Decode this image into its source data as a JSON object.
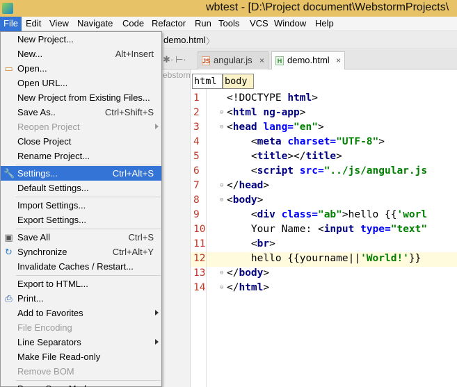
{
  "window": {
    "title": "wbtest - [D:\\Project document\\WebstormProjects\\"
  },
  "menubar": [
    "File",
    "Edit",
    "View",
    "Navigate",
    "Code",
    "Refactor",
    "Run",
    "Tools",
    "VCS",
    "Window",
    "Help"
  ],
  "navbar": {
    "breadcrumb": "demo.html"
  },
  "tabs": [
    {
      "label": "angular.js",
      "icon": "js-file-icon",
      "active": false
    },
    {
      "label": "demo.html",
      "icon": "html-file-icon",
      "active": true
    }
  ],
  "project_panel": {
    "label": "ebstorm"
  },
  "editor": {
    "crumbs": [
      "html",
      "body"
    ],
    "current_line": 12,
    "lines": [
      {
        "n": "1",
        "text": "<!DOCTYPE html>"
      },
      {
        "n": "2",
        "text": "<html ng-app>"
      },
      {
        "n": "3",
        "text": "<head lang=\"en\">"
      },
      {
        "n": "4",
        "text": "    <meta charset=\"UTF-8\">"
      },
      {
        "n": "5",
        "text": "    <title></title>"
      },
      {
        "n": "6",
        "text": "    <script src=\"../js/angular.js"
      },
      {
        "n": "7",
        "text": "</head>"
      },
      {
        "n": "8",
        "text": "<body>"
      },
      {
        "n": "9",
        "text": "    <div class=\"ab\">hello {{'worl"
      },
      {
        "n": "10",
        "text": "    Your Name: <input type=\"text\""
      },
      {
        "n": "11",
        "text": "    <br>"
      },
      {
        "n": "12",
        "text": "    hello {{yourname||'World!'}}"
      },
      {
        "n": "13",
        "text": "</body>"
      },
      {
        "n": "14",
        "text": "</html>"
      }
    ]
  },
  "file_menu": {
    "items": [
      {
        "label": "New Project...",
        "shortcut": ""
      },
      {
        "label": "New...",
        "shortcut": "Alt+Insert"
      },
      {
        "label": "Open...",
        "shortcut": "",
        "icon": "folder-icon"
      },
      {
        "label": "Open URL...",
        "shortcut": ""
      },
      {
        "label": "New Project from Existing Files...",
        "shortcut": ""
      },
      {
        "label": "Save As..",
        "shortcut": "Ctrl+Shift+S"
      },
      {
        "label": "Reopen Project",
        "shortcut": "",
        "disabled": true,
        "submenu": true
      },
      {
        "label": "Close Project",
        "shortcut": ""
      },
      {
        "label": "Rename Project...",
        "shortcut": ""
      },
      {
        "label": "Settings...",
        "shortcut": "Ctrl+Alt+S",
        "icon": "settings-wrench-icon",
        "highlighted": true
      },
      {
        "label": "Default Settings...",
        "shortcut": ""
      },
      {
        "label": "Import Settings...",
        "shortcut": ""
      },
      {
        "label": "Export Settings...",
        "shortcut": ""
      },
      {
        "label": "Save All",
        "shortcut": "Ctrl+S",
        "icon": "save-icon"
      },
      {
        "label": "Synchronize",
        "shortcut": "Ctrl+Alt+Y",
        "icon": "sync-icon"
      },
      {
        "label": "Invalidate Caches / Restart...",
        "shortcut": ""
      },
      {
        "label": "Export to HTML...",
        "shortcut": ""
      },
      {
        "label": "Print...",
        "shortcut": "",
        "icon": "printer-icon"
      },
      {
        "label": "Add to Favorites",
        "shortcut": "",
        "submenu": true
      },
      {
        "label": "File Encoding",
        "shortcut": "",
        "disabled": true
      },
      {
        "label": "Line Separators",
        "shortcut": "",
        "submenu": true
      },
      {
        "label": "Make File Read-only",
        "shortcut": ""
      },
      {
        "label": "Remove BOM",
        "shortcut": "",
        "disabled": true
      },
      {
        "label": "Power Save Mode",
        "shortcut": ""
      }
    ]
  },
  "colors": {
    "menu_highlight": "#3574d7",
    "title_bar": "#e8c266",
    "current_line": "#fffbdc",
    "line_number": "#c0392b"
  }
}
